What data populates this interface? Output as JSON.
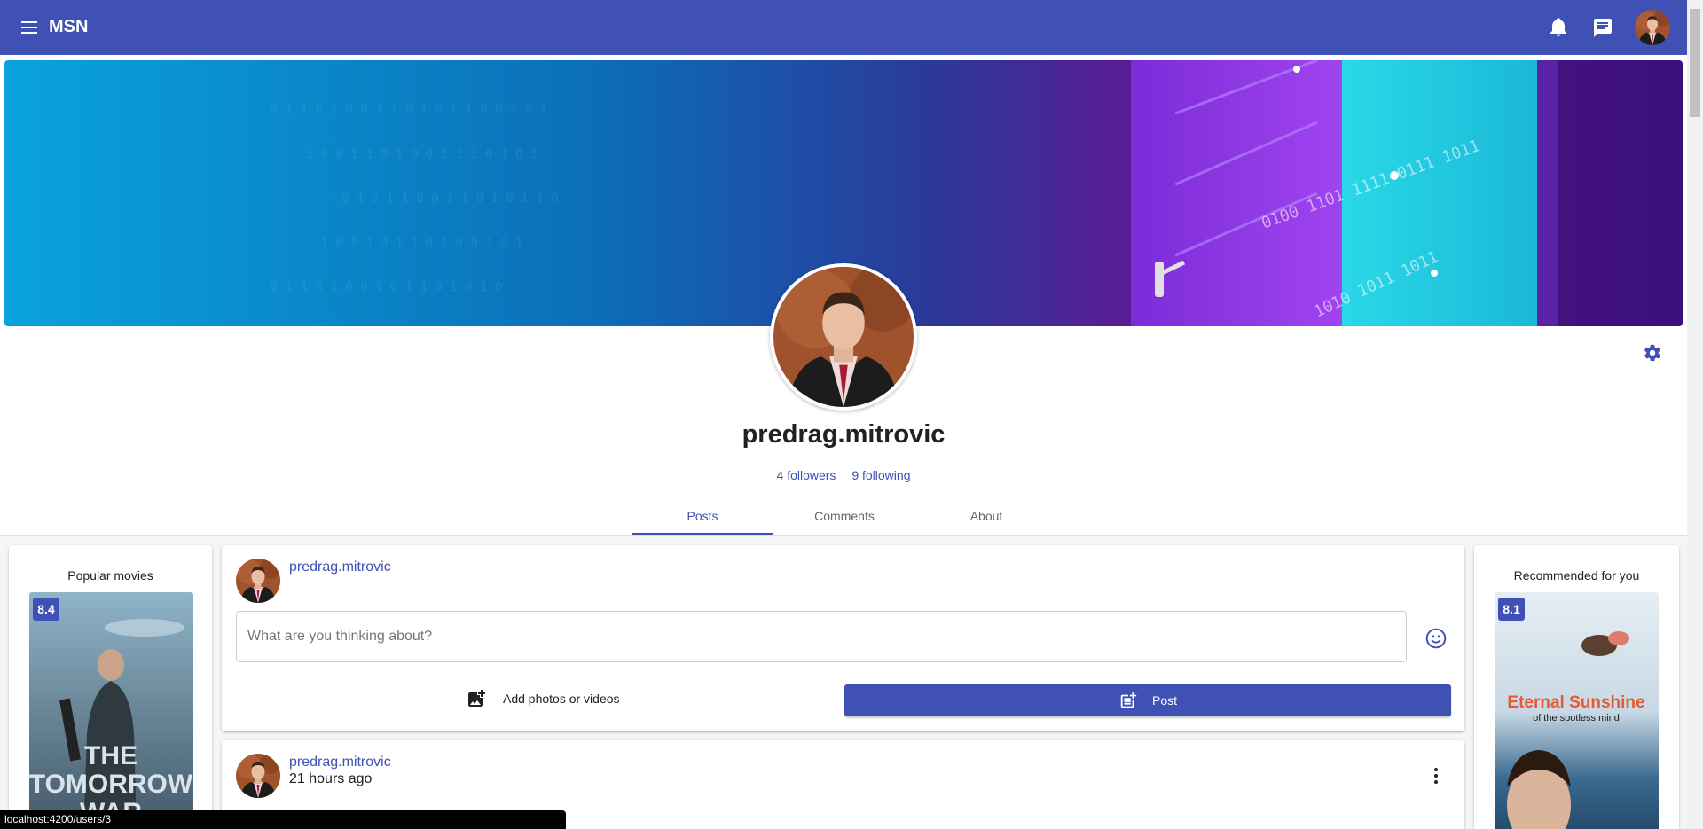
{
  "app": {
    "title": "MSN"
  },
  "profile": {
    "username": "predrag.mitrovic",
    "followers": "4 followers",
    "following": "9 following"
  },
  "tabs": [
    "Posts",
    "Comments",
    "About"
  ],
  "left_sidebar": {
    "title": "Popular movies",
    "movie": {
      "rating": "8.4",
      "poster_text": [
        "THE",
        "TOMORROW",
        "WAR"
      ]
    }
  },
  "right_sidebar": {
    "title": "Recommended for you",
    "movie": {
      "rating": "8.1",
      "poster_text": [
        "Eternal Sunshine",
        "of the spotless mind"
      ]
    }
  },
  "composer": {
    "username": "predrag.mitrovic",
    "placeholder": "What are you thinking about?",
    "add_media_label": "Add photos or videos",
    "post_label": "Post"
  },
  "post": {
    "username": "predrag.mitrovic",
    "time": "21 hours ago"
  },
  "status_bar": {
    "url": "localhost:4200/users/3"
  },
  "colors": {
    "primary": "#3f51b5"
  }
}
